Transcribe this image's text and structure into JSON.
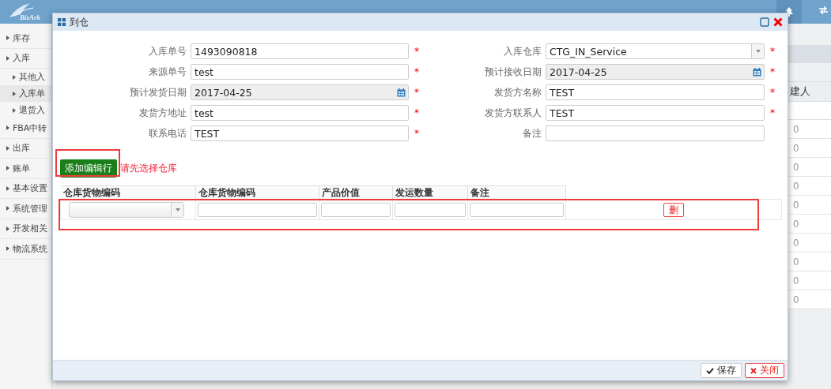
{
  "logo": {
    "text": "BizArk"
  },
  "sidebar": {
    "items": [
      {
        "label": "库存",
        "selected": false
      },
      {
        "label": "入库",
        "selected": false,
        "children": [
          {
            "label": "其他入",
            "selected": false
          },
          {
            "label": "入库单",
            "selected": true
          },
          {
            "label": "退货入",
            "selected": false
          }
        ]
      },
      {
        "label": "FBA中转",
        "selected": false
      },
      {
        "label": "出库",
        "selected": false
      },
      {
        "label": "账单",
        "selected": false
      },
      {
        "label": "基本设置",
        "selected": false
      },
      {
        "label": "系统管理",
        "selected": false
      },
      {
        "label": "开发相关",
        "selected": false
      },
      {
        "label": "物流系统",
        "selected": false
      }
    ]
  },
  "background_table": {
    "column_header": "建人",
    "cells": [
      "0",
      "0",
      "0",
      "0",
      "0",
      "0",
      "0",
      "0",
      "0",
      "0"
    ]
  },
  "dialog": {
    "title": "到仓",
    "fields": [
      {
        "label": "入库单号",
        "value": "1493090818",
        "kind": "text",
        "required_mark": "*"
      },
      {
        "label": "入库仓库",
        "value": "CTG_IN_Service",
        "kind": "select",
        "required_mark": "*"
      },
      {
        "label": "来源单号",
        "value": "test",
        "kind": "text",
        "required_mark": "*"
      },
      {
        "label": "预计接收日期",
        "value": "2017-04-25",
        "kind": "date",
        "required_mark": "*"
      },
      {
        "label": "预计发货日期",
        "value": "2017-04-25",
        "kind": "date",
        "required_mark": "*"
      },
      {
        "label": "发货方名称",
        "value": "TEST",
        "kind": "text",
        "required_mark": "*"
      },
      {
        "label": "发货方地址",
        "value": "test",
        "kind": "text",
        "required_mark": "*"
      },
      {
        "label": "发货方联系人",
        "value": "TEST",
        "kind": "text",
        "required_mark": "*"
      },
      {
        "label": "联系电话",
        "value": "TEST",
        "kind": "text",
        "required_mark": "*"
      },
      {
        "label": "备注",
        "kind": "text"
      }
    ],
    "add_button": "添加编辑行",
    "hint": "请先选择仓库",
    "table": {
      "columns": [
        "仓库货物编码",
        "仓库货物编码",
        "产品价值",
        "发运数量",
        "备注"
      ],
      "rows": [
        {
          "cells": [
            {
              "kind": "select"
            },
            {
              "kind": "input"
            },
            {
              "kind": "input"
            },
            {
              "kind": "input"
            },
            {
              "kind": "input"
            }
          ],
          "delete_button": "删"
        }
      ]
    },
    "buttons": [
      {
        "label": "保存",
        "kind": "save"
      },
      {
        "label": "关闭",
        "kind": "close"
      }
    ]
  }
}
